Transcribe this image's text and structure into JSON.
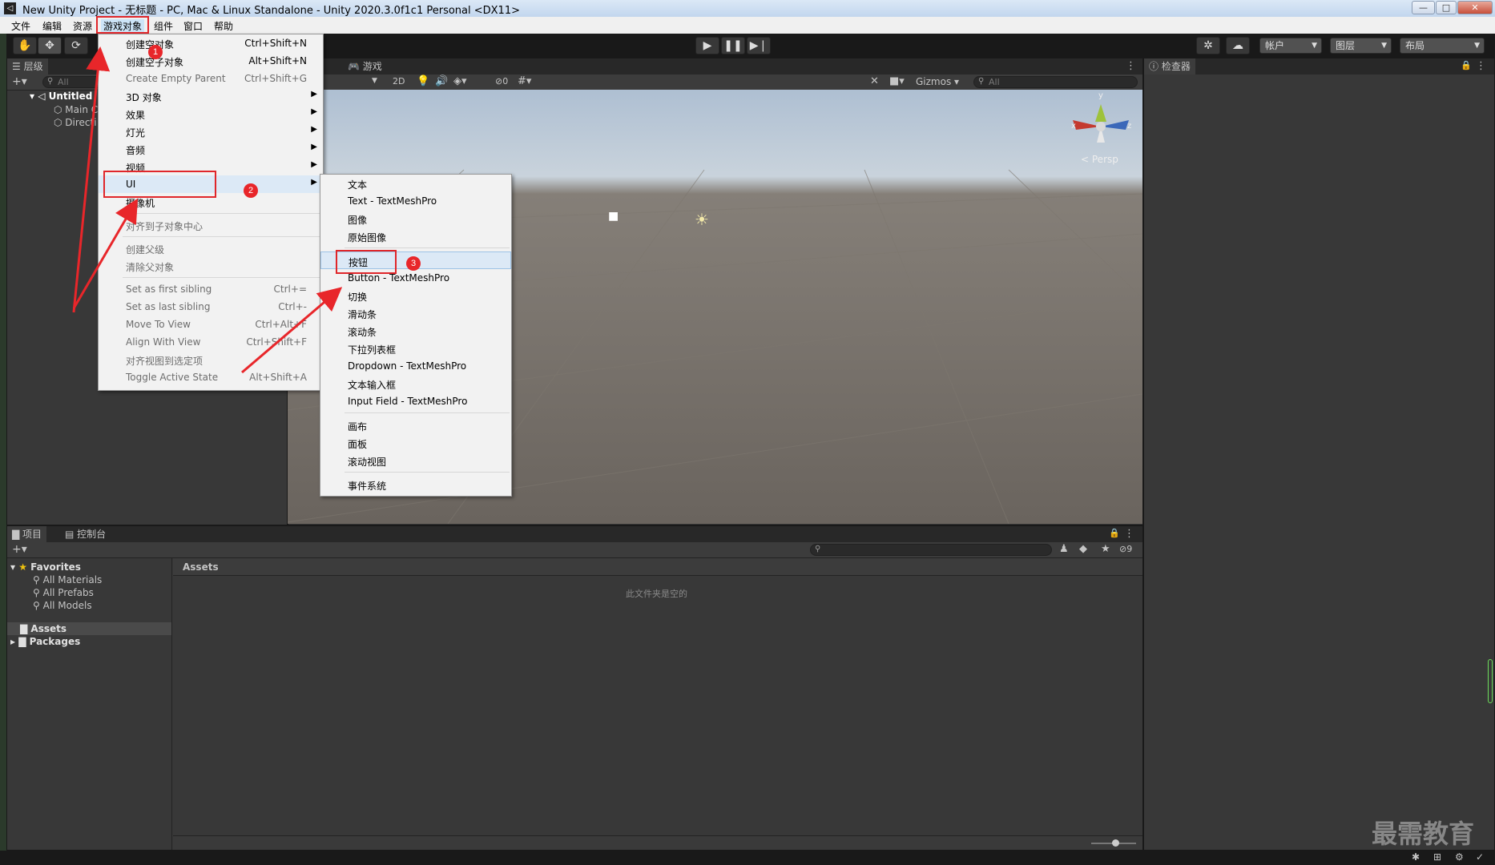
{
  "window": {
    "title": "New Unity Project - 无标题 - PC, Mac & Linux Standalone - Unity 2020.3.0f1c1 Personal <DX11>",
    "controls": [
      "—",
      "□",
      "✕"
    ]
  },
  "menubar": {
    "items": [
      "文件",
      "编辑",
      "资源",
      "游戏对象",
      "组件",
      "窗口",
      "帮助"
    ]
  },
  "toolbar": {
    "account": "帐户",
    "layers": "图层",
    "layout": "布局"
  },
  "hierarchy": {
    "tab": "层级",
    "search_placeholder": "All",
    "scene": "Untitled",
    "items": [
      "Main C",
      "Directi"
    ]
  },
  "scene": {
    "tab_game": "游戏",
    "btn_2d": "2D",
    "hidden_count": "0",
    "gizmos": "Gizmos",
    "search_placeholder": "All",
    "persp": "Persp",
    "axis_y": "y",
    "axis_x": "x",
    "axis_z": "z"
  },
  "inspector": {
    "tab": "检查器"
  },
  "gameobject_menu": {
    "items": [
      {
        "label": "创建空对象",
        "shortcut": "Ctrl+Shift+N"
      },
      {
        "label": "创建空子对象",
        "shortcut": "Alt+Shift+N"
      },
      {
        "label": "Create Empty Parent",
        "shortcut": "Ctrl+Shift+G"
      },
      {
        "label": "3D 对象"
      },
      {
        "label": "效果"
      },
      {
        "label": "灯光"
      },
      {
        "label": "音频"
      },
      {
        "label": "视频"
      },
      {
        "label": "UI"
      },
      {
        "label": "摄像机"
      },
      {
        "label": "对齐到子对象中心"
      },
      {
        "label": "创建父级"
      },
      {
        "label": "清除父对象"
      },
      {
        "label": "Set as first sibling",
        "shortcut": "Ctrl+="
      },
      {
        "label": "Set as last sibling",
        "shortcut": "Ctrl+-"
      },
      {
        "label": "Move To View",
        "shortcut": "Ctrl+Alt+F"
      },
      {
        "label": "Align With View",
        "shortcut": "Ctrl+Shift+F"
      },
      {
        "label": "对齐视图到选定项"
      },
      {
        "label": "Toggle Active State",
        "shortcut": "Alt+Shift+A"
      }
    ]
  },
  "ui_submenu": {
    "items": [
      "文本",
      "Text - TextMeshPro",
      "图像",
      "原始图像",
      "按钮",
      "Button - TextMeshPro",
      "切换",
      "滑动条",
      "滚动条",
      "下拉列表框",
      "Dropdown - TextMeshPro",
      "文本输入框",
      "Input Field - TextMeshPro",
      "画布",
      "面板",
      "滚动视图",
      "事件系统"
    ]
  },
  "annotations": {
    "badges": [
      "1",
      "2",
      "3"
    ]
  },
  "project": {
    "tab_project": "项目",
    "tab_console": "控制台",
    "hidden_count": "9",
    "favorites": "Favorites",
    "favorite_items": [
      "All Materials",
      "All Prefabs",
      "All Models"
    ],
    "assets": "Assets",
    "packages": "Packages",
    "breadcrumb": "Assets",
    "empty_message": "此文件夹是空的"
  },
  "watermark": "最需教育",
  "colors": {
    "editor_bg": "#383838",
    "toolbar_bg": "#191919",
    "menu_bg": "#f2f2f2",
    "annotation_red": "#e0262a",
    "selection": "#dce9f6"
  }
}
